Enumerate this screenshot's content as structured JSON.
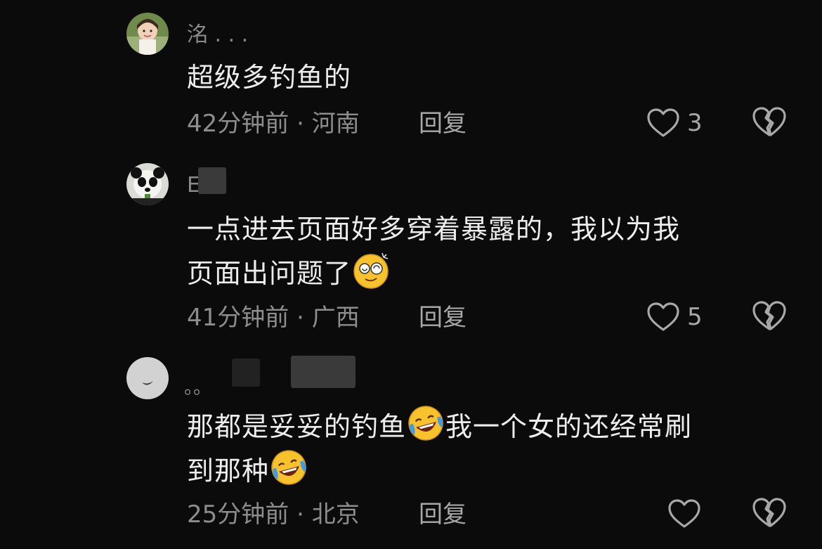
{
  "comments": [
    {
      "username": "洺 . . .",
      "text": "超级多钓鱼的",
      "time": "42分钟前",
      "location": "河南",
      "reply_label": "回复",
      "likes": "3",
      "avatar_icon": "girl-photo-avatar"
    },
    {
      "username": "E",
      "text_line1": "一点进去页面好多穿着暴露的，我以为我",
      "text_line2": "页面出问题了",
      "emoji": "dizzy-face-icon",
      "time": "41分钟前",
      "location": "广西",
      "reply_label": "回复",
      "likes": "5",
      "avatar_icon": "panda-avatar"
    },
    {
      "username": "。。",
      "text_line1a": "那都是妥妥的钓鱼",
      "text_line1b": "我一个女的还经常刷",
      "text_line2": "到那种",
      "emoji": "laughing-crying-icon",
      "time": "25分钟前",
      "location": "北京",
      "reply_label": "回复",
      "likes": "",
      "avatar_icon": "moon-avatar"
    }
  ],
  "meta_separator": " · ",
  "colors": {
    "background": "#0b0b0b",
    "text": "#ededed",
    "muted": "#8d8d8d"
  }
}
